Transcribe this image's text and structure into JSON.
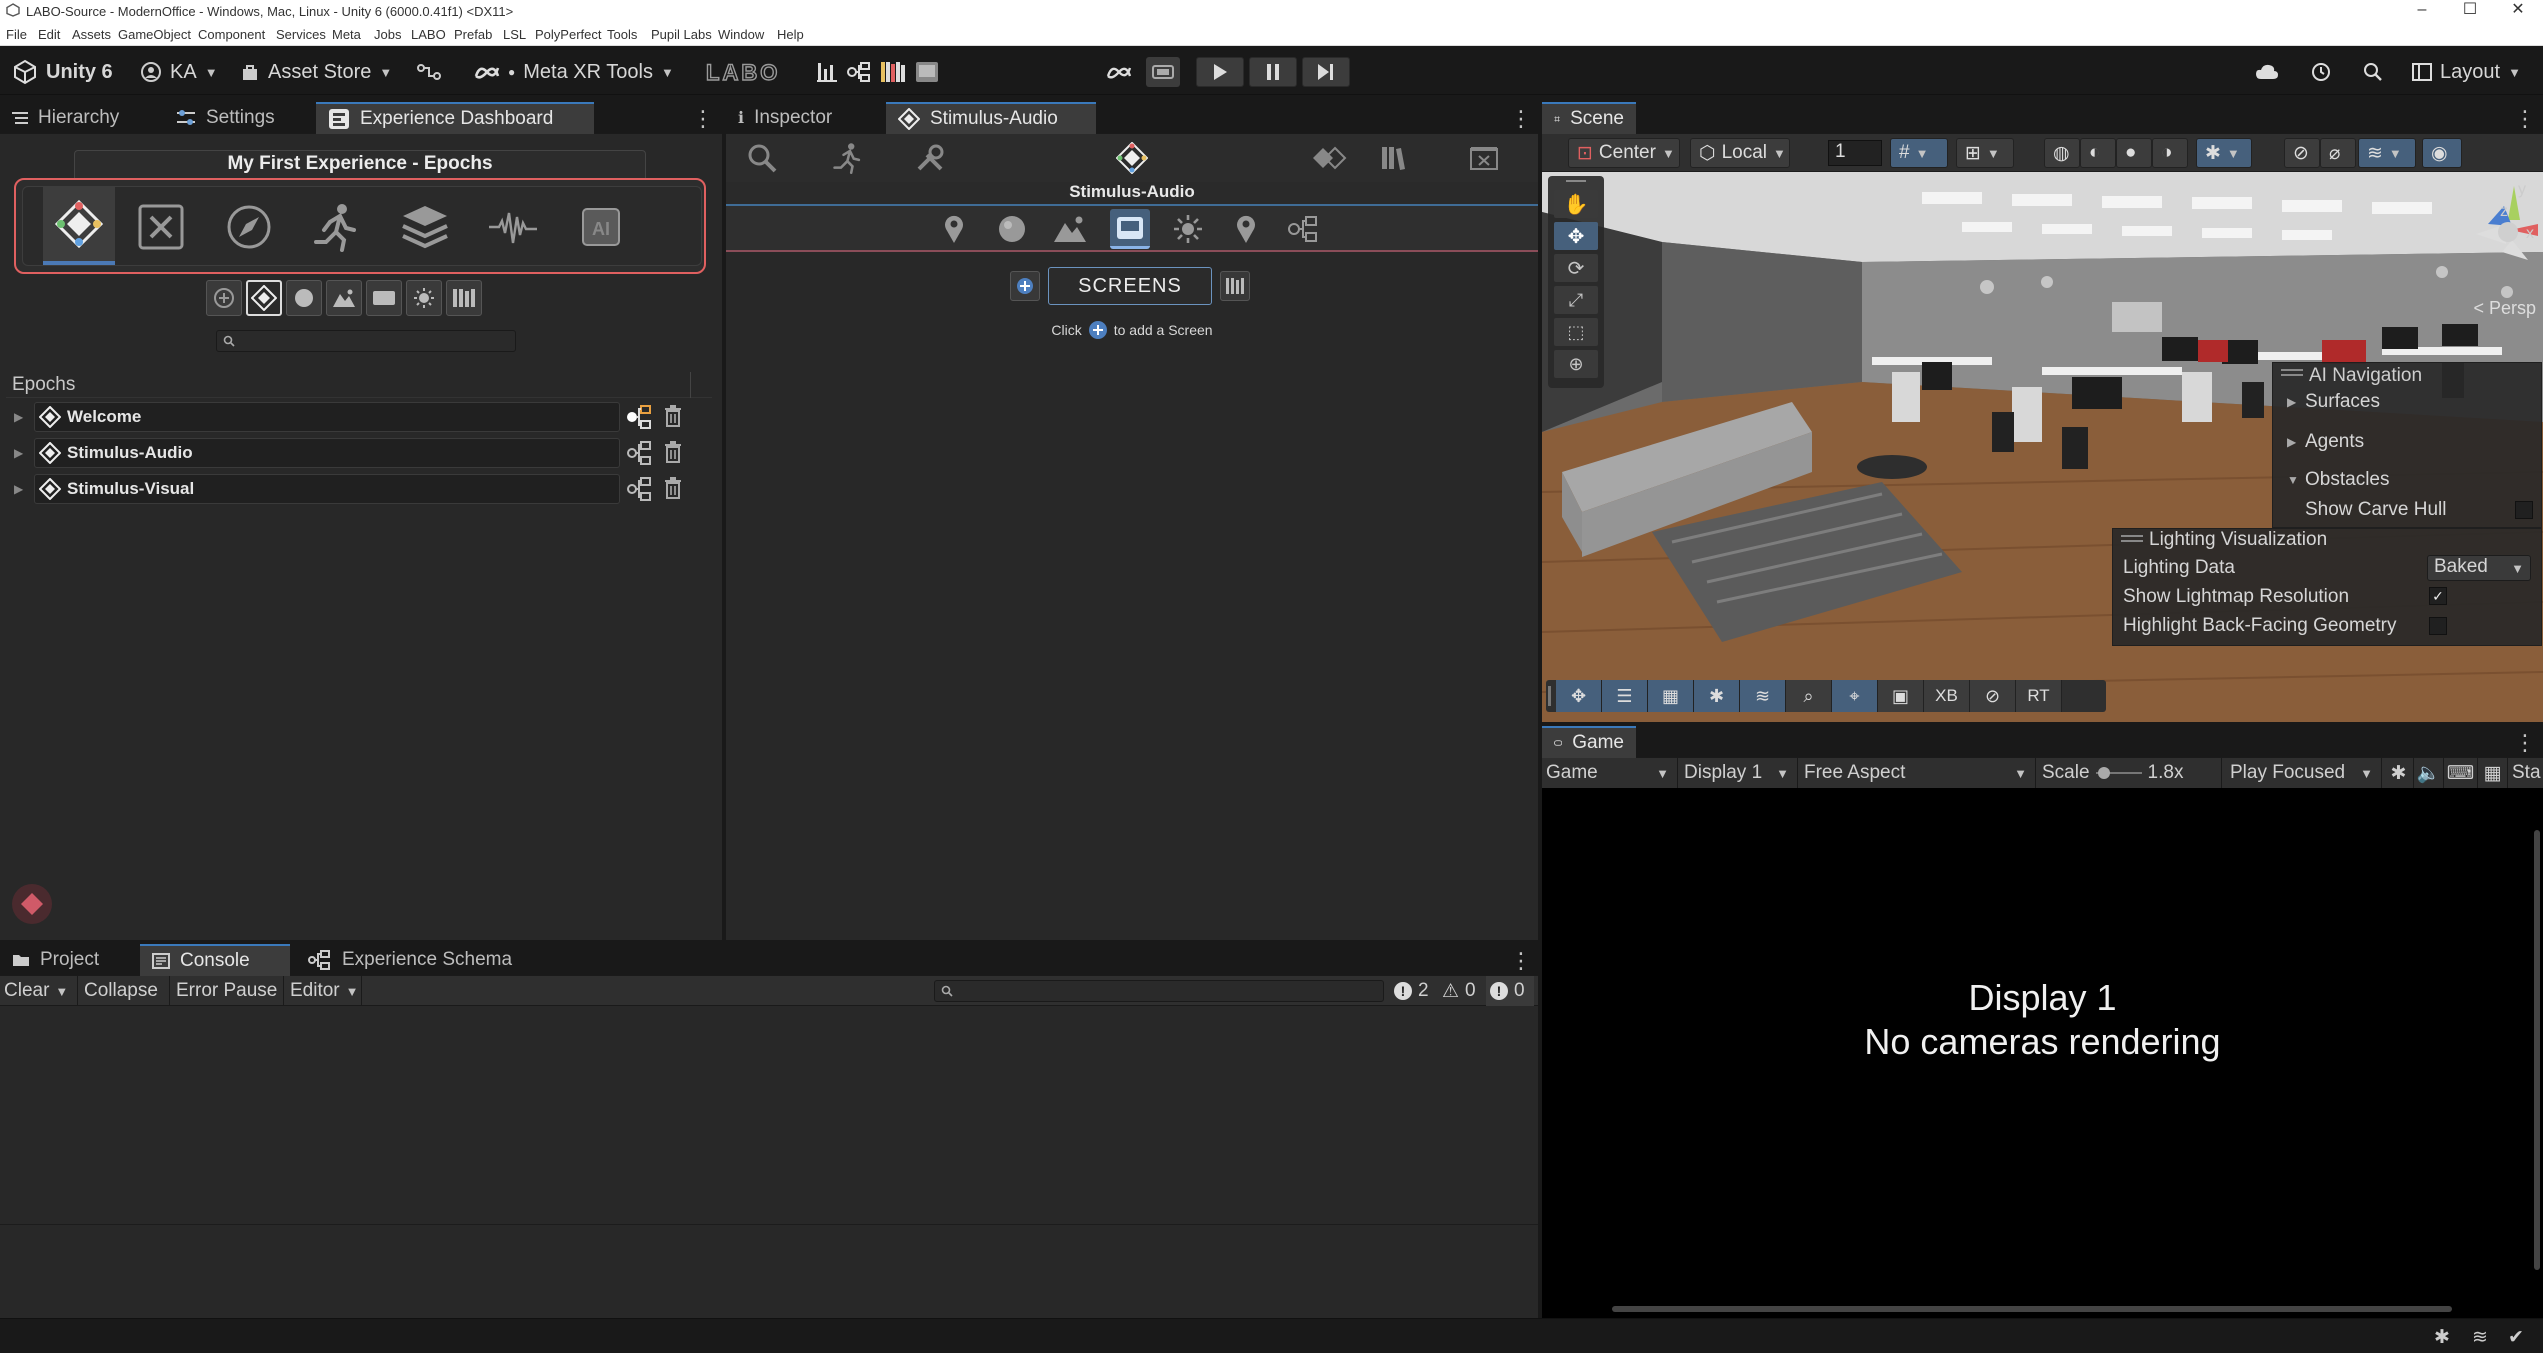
{
  "window": {
    "title": "LABO-Source - ModernOffice - Windows, Mac, Linux - Unity 6 (6000.0.41f1) <DX11>"
  },
  "menu": [
    "File",
    "Edit",
    "Assets",
    "GameObject",
    "Component",
    "Services",
    "Meta",
    "Jobs",
    "LABO",
    "Prefab",
    "LSL",
    "PolyPerfect",
    "Tools",
    "Pupil Labs",
    "Window",
    "Help"
  ],
  "toolbar": {
    "unity_label": "Unity 6",
    "account": "KA",
    "asset_store": "Asset Store",
    "meta_xr": "Meta XR Tools",
    "labo_logo": "LABO",
    "cloud_icon": "cloud-icon",
    "layout": "Layout"
  },
  "left_panel": {
    "tabs": [
      "Hierarchy",
      "Settings",
      "Experience Dashboard"
    ],
    "header": "My First Experience - Epochs",
    "section": "Epochs",
    "epochs": [
      {
        "label": "Welcome"
      },
      {
        "label": "Stimulus-Audio"
      },
      {
        "label": "Stimulus-Visual"
      }
    ]
  },
  "inspector": {
    "tabs": [
      "Inspector",
      "Stimulus-Audio"
    ],
    "title": "Stimulus-Audio",
    "screens_label": "SCREENS",
    "hint_prefix": "Click",
    "hint_suffix": "to add a Screen"
  },
  "scene": {
    "tab": "Scene",
    "pivot": "Center",
    "space": "Local",
    "snap_value": "1",
    "persp": "< Persp",
    "gizmo_labels": {
      "y": "y",
      "z": "z",
      "x": "x"
    },
    "ai_nav": {
      "title": "AI Navigation",
      "items": [
        "Surfaces",
        "Agents",
        "Obstacles"
      ],
      "show_carve": "Show Carve Hull"
    },
    "lighting": {
      "title": "Lighting Visualization",
      "data_label": "Lighting Data",
      "data_value": "Baked",
      "lightmap_label": "Show Lightmap Resolution",
      "backface_label": "Highlight Back-Facing Geometry"
    },
    "bottom_tools": [
      "XB",
      "RT"
    ]
  },
  "game": {
    "tab": "Game",
    "mode": "Game",
    "display": "Display 1",
    "aspect": "Free Aspect",
    "scale_label": "Scale",
    "scale_value": "1.8x",
    "play_mode": "Play Focused",
    "stats_label": "Sta",
    "msg_line1": "Display 1",
    "msg_line2": "No cameras rendering"
  },
  "console": {
    "tabs": [
      "Project",
      "Console",
      "Experience Schema"
    ],
    "clear": "Clear",
    "collapse": "Collapse",
    "error_pause": "Error Pause",
    "editor": "Editor",
    "counts": {
      "errors": "2",
      "warnings": "0",
      "logs": "0"
    }
  },
  "colors": {
    "accent": "#3a79bb",
    "highlight_border": "#e06060",
    "epoch_bar": "#e8a040"
  }
}
